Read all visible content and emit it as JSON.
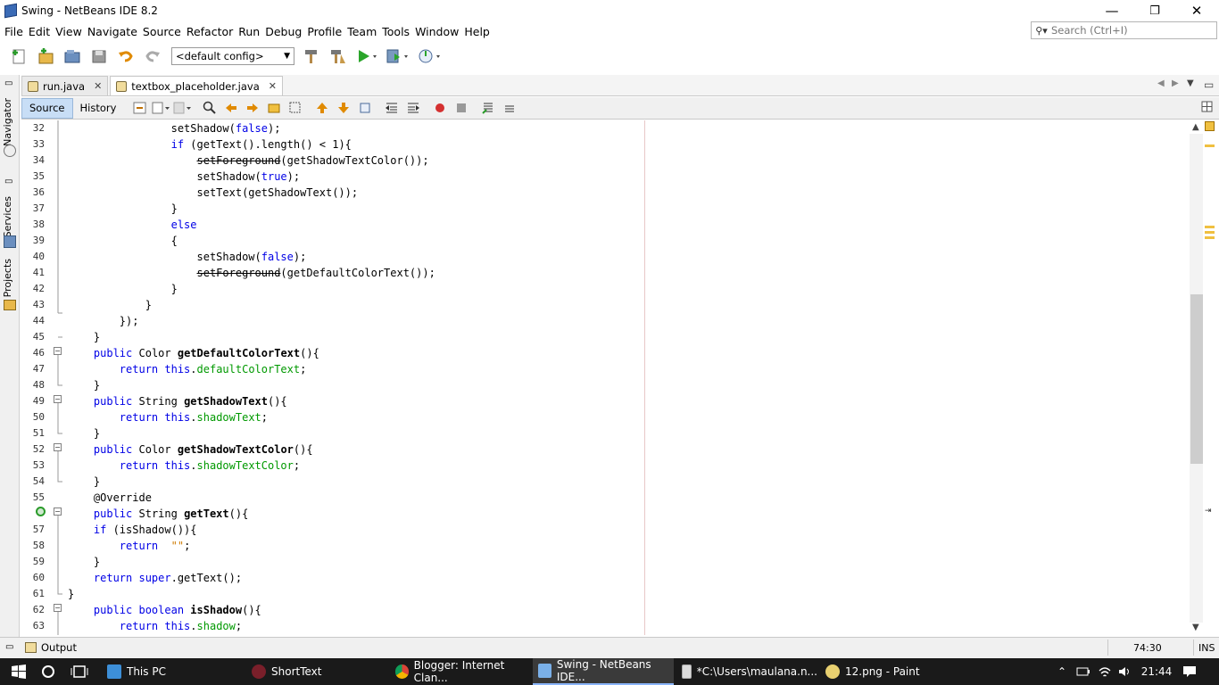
{
  "window": {
    "title": "Swing - NetBeans IDE 8.2",
    "minimize": "—",
    "maximize": "❐",
    "close": "✕"
  },
  "menu": [
    "File",
    "Edit",
    "View",
    "Navigate",
    "Source",
    "Refactor",
    "Run",
    "Debug",
    "Profile",
    "Team",
    "Tools",
    "Window",
    "Help"
  ],
  "search": {
    "placeholder": "Search (Ctrl+I)",
    "icon": "search-icon"
  },
  "toolbar": {
    "config": "<default config>"
  },
  "sidebar": {
    "navigator": "Navigator",
    "services": "Services",
    "projects": "Projects"
  },
  "tabs": [
    {
      "label": "run.java"
    },
    {
      "label": "textbox_placeholder.java"
    }
  ],
  "editor": {
    "source": "Source",
    "history": "History"
  },
  "lines": [
    "32",
    "33",
    "34",
    "35",
    "36",
    "37",
    "38",
    "39",
    "40",
    "41",
    "42",
    "43",
    "44",
    "45",
    "46",
    "47",
    "48",
    "49",
    "50",
    "51",
    "52",
    "53",
    "54",
    "55",
    "56",
    "57",
    "58",
    "59",
    "60",
    "61",
    "62",
    "63"
  ],
  "bottom": {
    "output": "Output",
    "position": "74:30",
    "mode": "INS"
  },
  "taskbar": {
    "items": [
      "This PC",
      "ShortText",
      "Blogger: Internet Clan...",
      "Swing - NetBeans IDE...",
      "*C:\\Users\\maulana.n...",
      "12.png - Paint"
    ],
    "clock": "21:44"
  }
}
